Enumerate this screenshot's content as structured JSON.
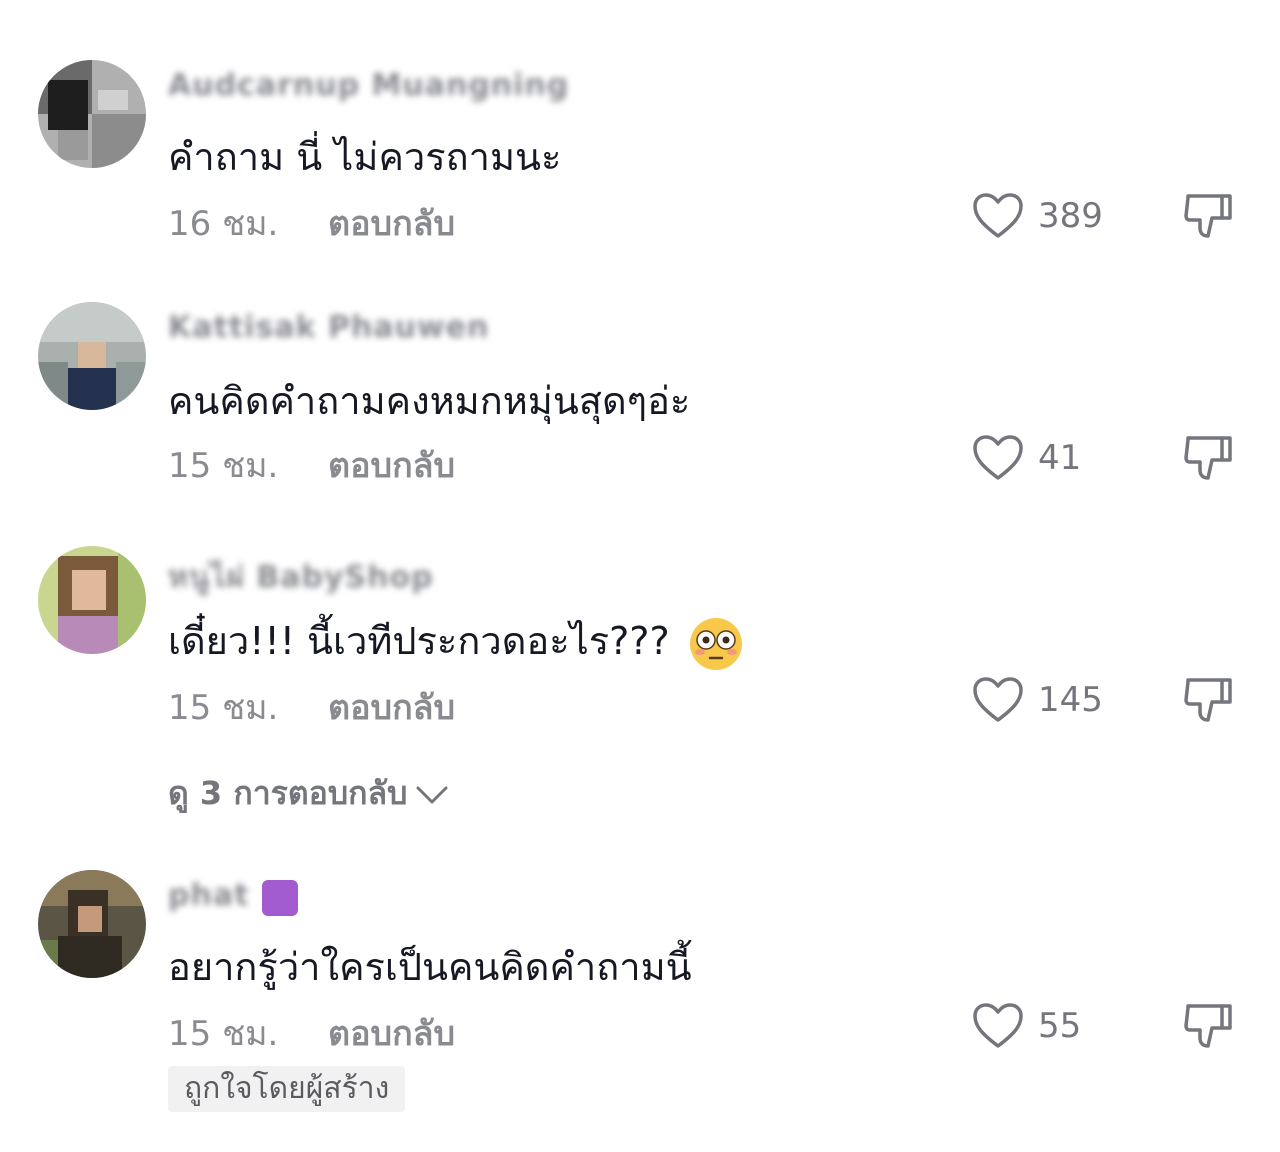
{
  "comments": [
    {
      "username": "Audcarnup Muangning",
      "text": "คำถาม นี่ ไม่ควรถามนะ",
      "time": "16 ชม.",
      "reply_label": "ตอบกลับ",
      "likes": "389",
      "avatar_colors": [
        "#3a3a3a",
        "#9a9a9a"
      ]
    },
    {
      "username": "Kattisak Phauwen",
      "text": "คนคิดคำถามคงหมกหมุ่นสุดๆอ่ะ",
      "time": "15 ชม.",
      "reply_label": "ตอบกลับ",
      "likes": "41",
      "avatar_colors": [
        "#8c9a9a",
        "#2b3a5a"
      ]
    },
    {
      "username": "หนูไผ่ BabyShop",
      "text": "เดี๋ยว!!! นี้เวทีประกวดอะไร???",
      "time": "15 ชม.",
      "reply_label": "ตอบกลับ",
      "likes": "145",
      "emoji": "flushed-face-emoji",
      "view_replies": "ดู 3 การตอบกลับ",
      "avatar_colors": [
        "#b3c96a",
        "#c9a48a"
      ]
    },
    {
      "username": "phat",
      "text": "อยากรู้ว่าใครเป็นคนคิดคำถามนี้",
      "time": "15 ชม.",
      "reply_label": "ตอบกลับ",
      "likes": "55",
      "liked_by_creator": "ถูกใจโดยผู้สร้าง",
      "avatar_colors": [
        "#4a4535",
        "#8a7a5a"
      ]
    }
  ],
  "colors": {
    "text_primary": "#161823",
    "text_secondary": "#8a8b91",
    "badge": "#a35ccf"
  }
}
